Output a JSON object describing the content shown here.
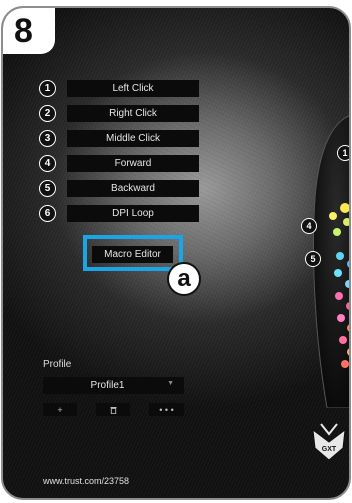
{
  "step": {
    "number": "8"
  },
  "buttons": [
    {
      "num": "1",
      "label": "Left Click"
    },
    {
      "num": "2",
      "label": "Right Click"
    },
    {
      "num": "3",
      "label": "Middle Click"
    },
    {
      "num": "4",
      "label": "Forward"
    },
    {
      "num": "5",
      "label": "Backward"
    },
    {
      "num": "6",
      "label": "DPI Loop"
    }
  ],
  "macro": {
    "label": "Macro Editor",
    "callout": "a",
    "highlight_color": "#1aa6e6"
  },
  "profile": {
    "label": "Profile",
    "selected": "Profile1",
    "actions": [
      {
        "label": "+"
      },
      {
        "label": ""
      },
      {
        "label": "• • •"
      }
    ]
  },
  "mouse_callouts": [
    {
      "num": "1"
    },
    {
      "num": "4"
    },
    {
      "num": "5"
    }
  ],
  "footer": {
    "url": "www.trust.com/23758"
  },
  "logo": {
    "text": "GXT"
  },
  "icons": {
    "delete": "trash-icon",
    "dropdown": "triangle-down-icon"
  }
}
